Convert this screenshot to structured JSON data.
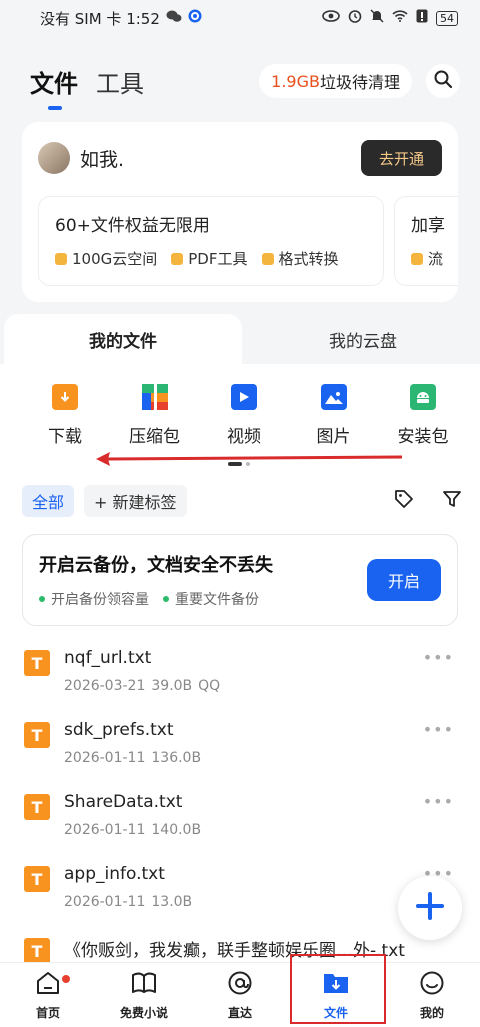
{
  "status_bar": {
    "carrier_time": "没有 SIM 卡 1:52",
    "battery": "54"
  },
  "header": {
    "tab_files": "文件",
    "tab_tools": "工具",
    "cleanup_size": "1.9GB",
    "cleanup_label": "垃圾待清理"
  },
  "vip_card": {
    "username": "如我.",
    "open_button": "去开通",
    "benefit_title": "60+文件权益无限用",
    "benefits": [
      "100G云空间",
      "PDF工具",
      "格式转换"
    ],
    "benefit2_title": "加享",
    "benefit2_item": "流"
  },
  "segments": {
    "my_files": "我的文件",
    "my_cloud": "我的云盘"
  },
  "categories": [
    {
      "label": "下载",
      "icon": "download-icon",
      "color": "#f7931e"
    },
    {
      "label": "压缩包",
      "icon": "archive-icon",
      "color": "#2bb673"
    },
    {
      "label": "视频",
      "icon": "video-icon",
      "color": "#1a63f0"
    },
    {
      "label": "图片",
      "icon": "image-icon",
      "color": "#1a63f0"
    },
    {
      "label": "安装包",
      "icon": "android-icon",
      "color": "#2bb673"
    }
  ],
  "filters": {
    "all": "全部",
    "new_tag": "+ 新建标签"
  },
  "backup": {
    "title": "开启云备份，文档安全不丢失",
    "sub1": "开启备份领容量",
    "sub2": "重要文件备份",
    "button": "开启"
  },
  "files": [
    {
      "name": "nqf_url.txt",
      "date": "2026-03-21",
      "size": "39.0B",
      "source": "QQ"
    },
    {
      "name": "sdk_prefs.txt",
      "date": "2026-01-11",
      "size": "136.0B",
      "source": ""
    },
    {
      "name": "ShareData.txt",
      "date": "2026-01-11",
      "size": "140.0B",
      "source": ""
    },
    {
      "name": "app_info.txt",
      "date": "2026-01-11",
      "size": "13.0B",
      "source": ""
    },
    {
      "name": "《你贩剑，我发癫，联手整顿娱乐圈…外-.txt",
      "date": "",
      "size": "",
      "source": ""
    }
  ],
  "bottom_nav": [
    "首页",
    "免费小说",
    "直达",
    "文件",
    "我的"
  ],
  "colors": {
    "accent": "#1a63f0",
    "file_icon": "#f7931e",
    "highlight": "#d92b2b"
  }
}
